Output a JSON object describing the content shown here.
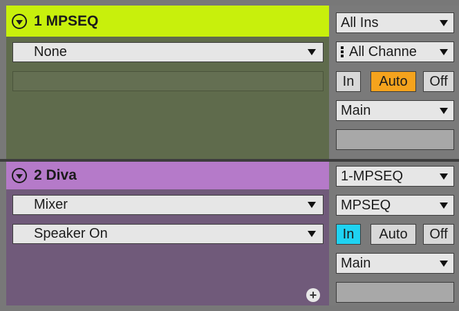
{
  "tracks": [
    {
      "name": "1 MPSEQ",
      "header_color": "#c8f00c",
      "instrument_select": "None",
      "input_type": "All Ins",
      "input_channel": "All Channe",
      "monitor": {
        "in": "In",
        "auto": "Auto",
        "off": "Off",
        "active": "auto"
      },
      "output": "Main"
    },
    {
      "name": "2 Diva",
      "header_color": "#b57ac9",
      "instrument_select": "Mixer",
      "instrument_sub_select": "Speaker On",
      "input_type": "1-MPSEQ",
      "input_channel": "MPSEQ",
      "monitor": {
        "in": "In",
        "auto": "Auto",
        "off": "Off",
        "active": "in"
      },
      "output": "Main"
    }
  ],
  "icons": {
    "fold": "circle-chevron-down-icon",
    "channel": "channel-grid-icon",
    "dropdown": "triangle-down-icon",
    "add": "plus-circle-icon"
  }
}
